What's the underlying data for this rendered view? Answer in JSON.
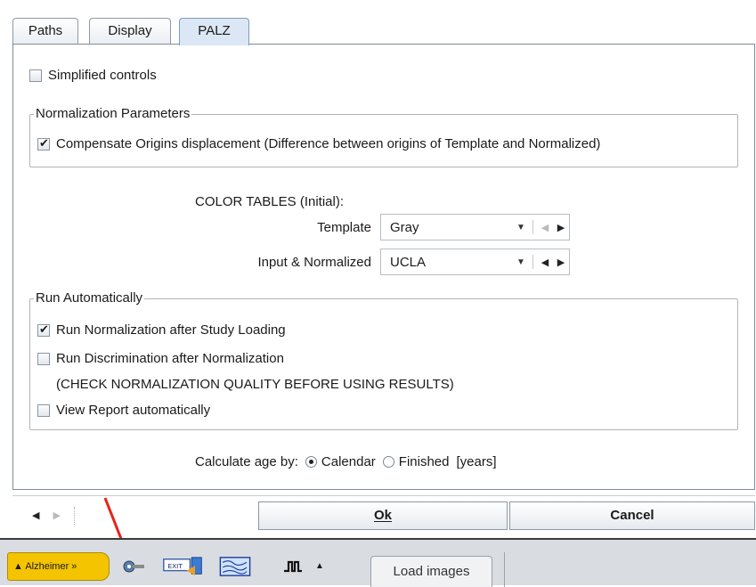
{
  "tabs": [
    {
      "label": "Paths"
    },
    {
      "label": "Display"
    },
    {
      "label": "PALZ"
    }
  ],
  "simplified_controls": {
    "label": "Simplified controls",
    "checked": false
  },
  "normalization": {
    "legend": "Normalization Parameters",
    "compensate": {
      "label": "Compensate Origins displacement (Difference between origins of Template and Normalized)",
      "checked": true
    }
  },
  "color_tables": {
    "heading": "COLOR TABLES (Initial):",
    "template": {
      "label": "Template",
      "value": "Gray"
    },
    "input": {
      "label": "Input & Normalized",
      "value": "UCLA"
    }
  },
  "run_auto": {
    "legend": "Run Automatically",
    "run_normalization": {
      "label": "Run Normalization after Study Loading",
      "checked": true
    },
    "run_discrimination": {
      "label": "Run Discrimination after Normalization",
      "checked": false
    },
    "warning": "(CHECK NORMALIZATION QUALITY BEFORE USING RESULTS)",
    "view_report": {
      "label": "View Report automatically",
      "checked": false
    }
  },
  "age": {
    "label": "Calculate age by:",
    "options": [
      {
        "label": "Calendar",
        "selected": true
      },
      {
        "label": "Finished",
        "selected": false
      }
    ],
    "unit": "[years]"
  },
  "buttons": {
    "ok": "Ok",
    "cancel": "Cancel"
  },
  "taskbar": {
    "module": "Alzheimer »",
    "load_images": "Load images",
    "exit_text": "EXIT"
  },
  "annotation_color": "#e8231a"
}
